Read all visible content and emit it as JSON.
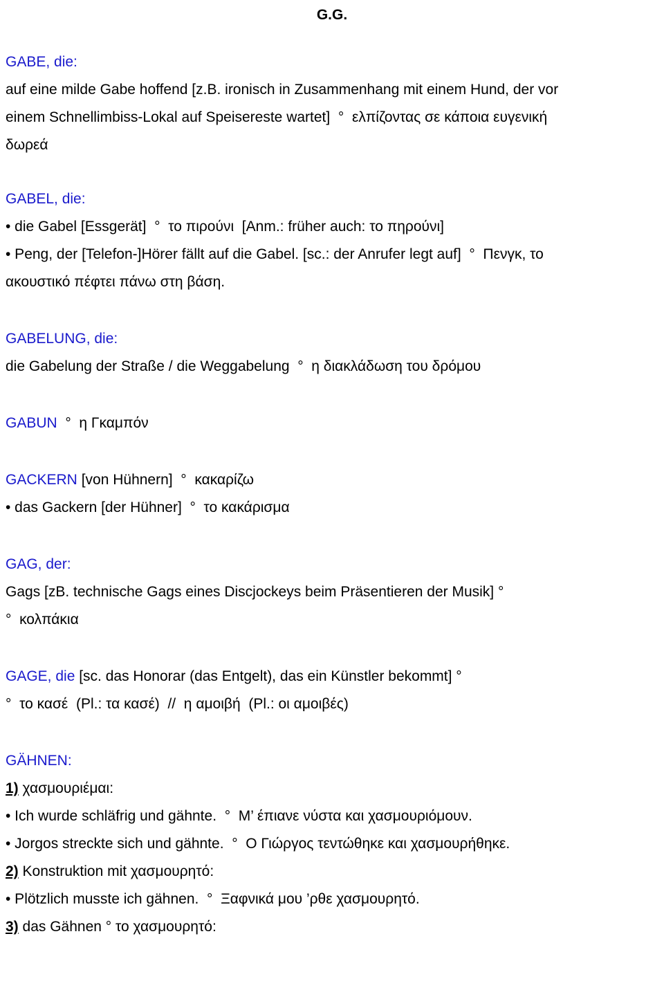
{
  "document": {
    "title": "G.G.",
    "accent_color": "#1a1aCC",
    "text_color": "#000000",
    "background_color": "#ffffff"
  },
  "entries": {
    "gabe": {
      "headword": "GABE, die:",
      "line1": "auf eine milde Gabe hoffend [z.B. ironisch in Zusammenhang mit einem Hund, der vor",
      "line2": "einem Schnellimbiss-Lokal auf Speisereste wartet]  °  ελπίζοντας σε κάποια ευγενική",
      "line3": "δωρεά"
    },
    "gabel": {
      "headword": "GABEL, die:",
      "bullet1": "• die Gabel [Essgerät]  °  το πιρούνι  [Anm.: früher auch: το πηρούνι]",
      "bullet2a": "• Peng, der [Telefon-]Hörer fällt auf die Gabel. [sc.: der Anrufer legt auf]  °  Πενγκ, το",
      "bullet2b": "ακουστικό πέφτει πάνω στη βάση."
    },
    "gabelung": {
      "headword": "GABELUNG, die:",
      "line1": "die Gabelung der Straße / die Weggabelung  °  η διακλάδωση του δρόμου"
    },
    "gabun": {
      "headword": "GABUN",
      "rest": "  °  η Γκαμπόν"
    },
    "gackern": {
      "headword": "GACKERN",
      "rest": " [von Hühnern]  °  κακαρίζω",
      "bullet1": "• das Gackern [der Hühner]  °  το κακάρισμα"
    },
    "gag": {
      "headword": "GAG, der:",
      "line1": "Gags [zB. technische Gags eines Discjockeys beim Präsentieren der Musik] °",
      "line2": "°  κολπάκια"
    },
    "gage": {
      "headword": "GAGE, die",
      "rest": " [sc. das Honorar (das Entgelt), das ein Künstler bekommt] °",
      "line2": "°  το κασέ  (Pl.: τα κασέ)  //  η αμοιβή  (Pl.: οι αμοιβές)"
    },
    "gaehnen": {
      "headword": "GÄHNEN:",
      "sense1_num": "1)",
      "sense1_text": " χασμουριέμαι:",
      "sense1_bullet1": "• Ich wurde schläfrig und gähnte.  °  Μ’ έπιανε νύστα και χασμουριόμουν.",
      "sense1_bullet2": "• Jorgos streckte sich und gähnte.  °  Ο Γιώργος τεντώθηκε και χασμουρήθηκε.",
      "sense2_num": "2)",
      "sense2_text": " Konstruktion mit χασμουρητό:",
      "sense2_bullet1": "• Plötzlich musste ich gähnen.  °  Ξαφνικά μου ’ρθε χασμουρητό.",
      "sense3_num": "3)",
      "sense3_text": " das Gähnen ° το χασμουρητό:"
    }
  }
}
